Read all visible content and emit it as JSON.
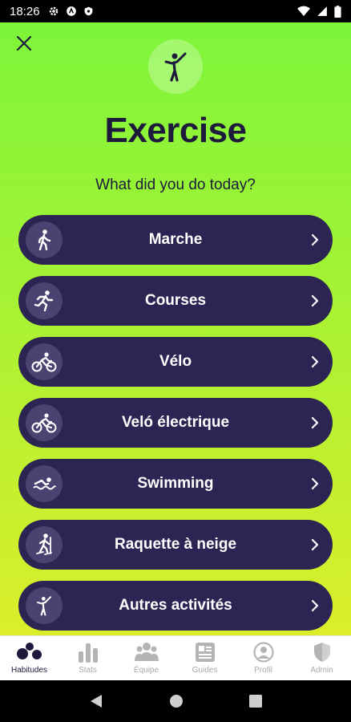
{
  "status_bar": {
    "time": "18:26"
  },
  "header": {
    "title": "Exercise",
    "subtitle": "What did you do today?"
  },
  "activities": [
    {
      "label": "Marche",
      "icon": "walking-icon"
    },
    {
      "label": "Courses",
      "icon": "running-icon"
    },
    {
      "label": "Vélo",
      "icon": "bicycle-icon"
    },
    {
      "label": "Veló électrique",
      "icon": "e-bike-icon"
    },
    {
      "label": "Swimming",
      "icon": "swimming-icon"
    },
    {
      "label": "Raquette à neige",
      "icon": "snowshoe-icon"
    },
    {
      "label": "Autres activités",
      "icon": "person-stretch-icon"
    }
  ],
  "bottom_nav": [
    {
      "label": "Habitudes",
      "icon": "habits-icon",
      "active": true
    },
    {
      "label": "Stats",
      "icon": "bar-chart-icon",
      "active": false
    },
    {
      "label": "Équipe",
      "icon": "team-icon",
      "active": false
    },
    {
      "label": "Guides",
      "icon": "guide-icon",
      "active": false
    },
    {
      "label": "Profil",
      "icon": "profile-icon",
      "active": false
    },
    {
      "label": "Admin",
      "icon": "shield-icon",
      "active": false
    }
  ],
  "colors": {
    "gradient_top": "#7df53a",
    "gradient_bottom": "#dcee2a",
    "pill": "#2c2452",
    "pill_icon_bg": "#4a4270",
    "title": "#1e1a3c"
  }
}
